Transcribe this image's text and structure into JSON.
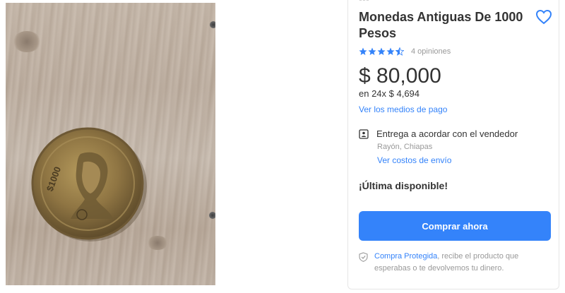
{
  "product": {
    "title": "Monedas Antiguas De 1000 Pesos",
    "rating": 4.5,
    "reviews_label": "4 opiniones",
    "price": "$ 80,000",
    "installments": "en 24x $ 4,694",
    "payment_link": "Ver los medios de pago",
    "delivery_text": "Entrega a acordar con el vendedor",
    "location": "Rayón, Chiapas",
    "shipping_link": "Ver costos de envío",
    "stock_notice": "¡Última disponible!",
    "buy_button": "Comprar ahora",
    "protection_link": "Compra Protegida",
    "protection_text": ", recibe el producto que esperabas o te devolvemos tu dinero."
  },
  "icons": {
    "favorite": "heart-outline-icon",
    "star": "star-icon",
    "delivery": "agreement-icon",
    "protection": "shield-check-icon"
  },
  "colors": {
    "accent": "#3483fa",
    "text": "#333333",
    "muted": "#999999"
  }
}
